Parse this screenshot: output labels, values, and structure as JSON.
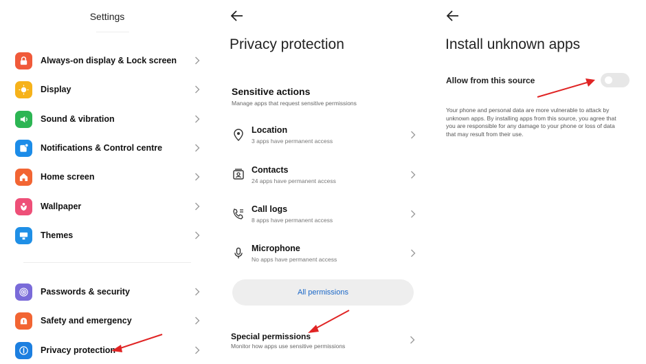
{
  "colors": {
    "accent_blue": "#1a67c7",
    "arrow_red": "#e02424",
    "toggle_off": "#e7e7e7"
  },
  "settings_panel": {
    "title": "Settings",
    "items": [
      {
        "label": "Always-on display & Lock screen",
        "icon": "lock-icon",
        "color": "#f05a3a"
      },
      {
        "label": "Display",
        "icon": "sun-icon",
        "color": "#f6b21a"
      },
      {
        "label": "Sound & vibration",
        "icon": "speaker-icon",
        "color": "#2cb553"
      },
      {
        "label": "Notifications & Control centre",
        "icon": "notification-icon",
        "color": "#1c8ce8"
      },
      {
        "label": "Home screen",
        "icon": "home-icon",
        "color": "#f26533"
      },
      {
        "label": "Wallpaper",
        "icon": "flower-icon",
        "color": "#ee4f78"
      },
      {
        "label": "Themes",
        "icon": "monitor-icon",
        "color": "#1f8fe6"
      },
      {
        "label": "Passwords & security",
        "icon": "fingerprint-icon",
        "color": "#7a6bd9"
      },
      {
        "label": "Safety and emergency",
        "icon": "alert-icon",
        "color": "#f26533"
      },
      {
        "label": "Privacy protection",
        "icon": "privacy-icon",
        "color": "#1c7fe0"
      }
    ]
  },
  "privacy_panel": {
    "title": "Privacy protection",
    "section_title": "Sensitive actions",
    "section_subtitle": "Manage apps that request sensitive permissions",
    "permissions": [
      {
        "label": "Location",
        "sub": "3 apps have permanent access",
        "icon": "location-pin-icon"
      },
      {
        "label": "Contacts",
        "sub": "24 apps have permanent access",
        "icon": "contacts-card-icon"
      },
      {
        "label": "Call logs",
        "sub": "8 apps have permanent access",
        "icon": "call-log-icon"
      },
      {
        "label": "Microphone",
        "sub": "No apps have permanent access",
        "icon": "microphone-icon"
      }
    ],
    "all_permissions_label": "All permissions",
    "special_title": "Special permissions",
    "special_subtitle": "Monitor how apps use sensitive permissions"
  },
  "install_panel": {
    "title": "Install unknown apps",
    "allow_label": "Allow from this source",
    "toggle_on": false,
    "warning": "Your phone and personal data are more vulnerable to attack by unknown apps. By installing apps from this source, you agree that you are responsible for any damage to your phone or loss of data that may result from their use."
  }
}
